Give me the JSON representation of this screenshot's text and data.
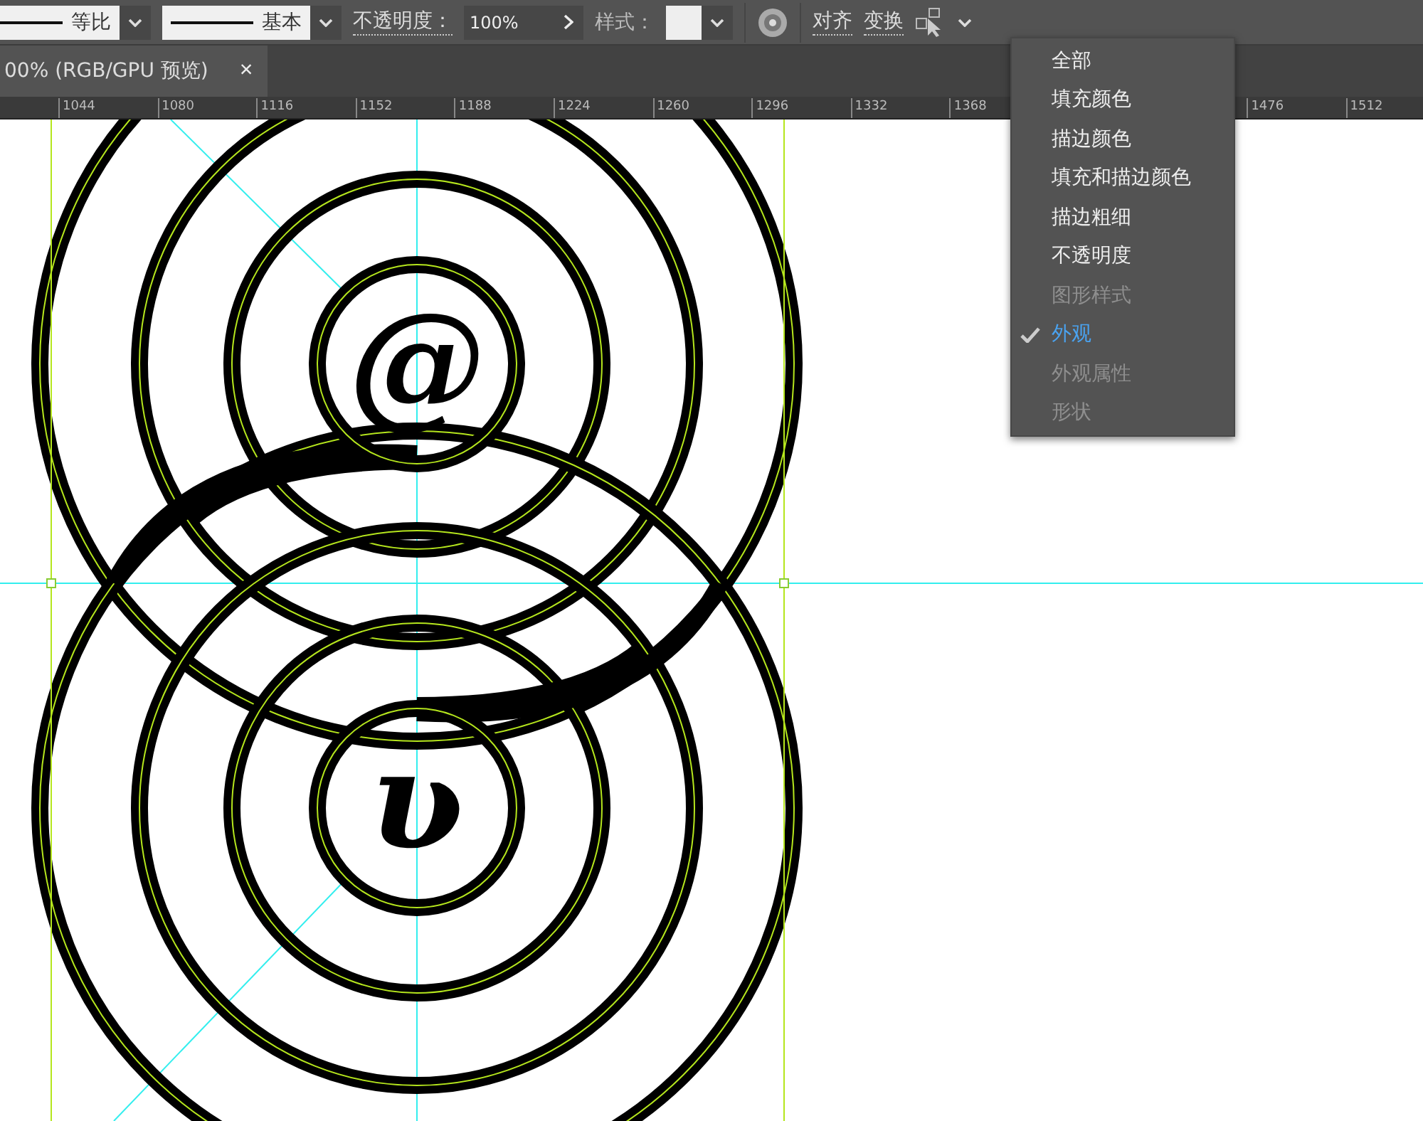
{
  "toolbar": {
    "stroke_profile": "等比",
    "brush": "基本",
    "opacity_label": "不透明度：",
    "opacity_value": "100%",
    "style_label": "样式：",
    "align": "对齐",
    "transform": "变换"
  },
  "document_tab": {
    "title": "00% (RGB/GPU 预览)",
    "close": "×"
  },
  "ruler": [
    "1044",
    "1080",
    "1116",
    "1152",
    "1188",
    "1224",
    "1260",
    "1296",
    "1332",
    "1368",
    "1476",
    "1512"
  ],
  "artwork": {
    "top_letter": "@",
    "bottom_letter": "ʋ"
  },
  "menu": [
    {
      "label": "全部",
      "checked": false,
      "disabled": false
    },
    {
      "label": "填充颜色",
      "checked": false,
      "disabled": false
    },
    {
      "label": "描边颜色",
      "checked": false,
      "disabled": false
    },
    {
      "label": "填充和描边颜色",
      "checked": false,
      "disabled": false
    },
    {
      "label": "描边粗细",
      "checked": false,
      "disabled": false
    },
    {
      "label": "不透明度",
      "checked": false,
      "disabled": false
    },
    {
      "label": "图形样式",
      "checked": false,
      "disabled": true
    },
    {
      "label": "外观",
      "checked": true,
      "disabled": false
    },
    {
      "label": "外观属性",
      "checked": false,
      "disabled": true
    },
    {
      "label": "形状",
      "checked": false,
      "disabled": true
    }
  ]
}
